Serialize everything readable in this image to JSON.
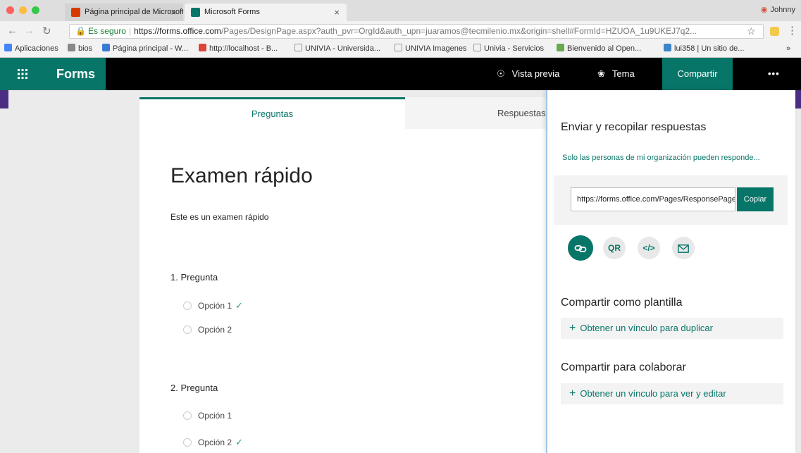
{
  "browser": {
    "tabs": [
      {
        "title": "Página principal de Microsoft"
      },
      {
        "title": "Microsoft Forms"
      }
    ],
    "profile_name": "Johnny",
    "secure_label": "Es seguro",
    "url_host": "https://forms.office.com",
    "url_path": "/Pages/DesignPage.aspx?auth_pvr=OrgId&auth_upn=juaramos@tecmilenio.mx&origin=shell#FormId=HZUOA_1u9UKEJ7q2..."
  },
  "bookmarks": [
    {
      "label": "Aplicaciones"
    },
    {
      "label": "bios"
    },
    {
      "label": "Página principal - W..."
    },
    {
      "label": "http://localhost - B..."
    },
    {
      "label": "UNIVIA - Universida..."
    },
    {
      "label": "UNIVIA Imagenes"
    },
    {
      "label": "Univia - Servicios"
    },
    {
      "label": "Bienvenido al Open..."
    },
    {
      "label": "lui358 | Un sitio de..."
    },
    {
      "label": "»"
    }
  ],
  "header": {
    "app_name": "Forms",
    "preview_label": "Vista previa",
    "theme_label": "Tema",
    "share_label": "Compartir",
    "more_label": "•••"
  },
  "tabs": {
    "questions": "Preguntas",
    "responses": "Respuestas"
  },
  "form": {
    "title": "Examen rápido",
    "description": "Este es un examen rápido",
    "questions": [
      {
        "label": "1. Pregunta",
        "options": [
          "Opción 1",
          "Opción 2"
        ],
        "correct_index": 0
      },
      {
        "label": "2. Pregunta",
        "options": [
          "Opción 1",
          "Opción 2"
        ],
        "correct_index": 1
      }
    ]
  },
  "share_panel": {
    "title": "Enviar y recopilar respuestas",
    "scope_text": "Solo las personas de mi organización pueden responde...",
    "link_value": "https://forms.office.com/Pages/ResponsePage.aspx",
    "copy_label": "Copiar",
    "icons": [
      "link-icon",
      "qr-icon",
      "embed-icon",
      "email-icon"
    ],
    "qr_label": "QR",
    "embed_label": "</>",
    "template_title": "Compartir como plantilla",
    "template_link": "Obtener un vínculo para duplicar",
    "collab_title": "Compartir para colaborar",
    "collab_link": "Obtener un vínculo para ver y editar"
  },
  "colors": {
    "accent": "#077568",
    "header_bg": "#000000",
    "scope_link": "#077568"
  }
}
